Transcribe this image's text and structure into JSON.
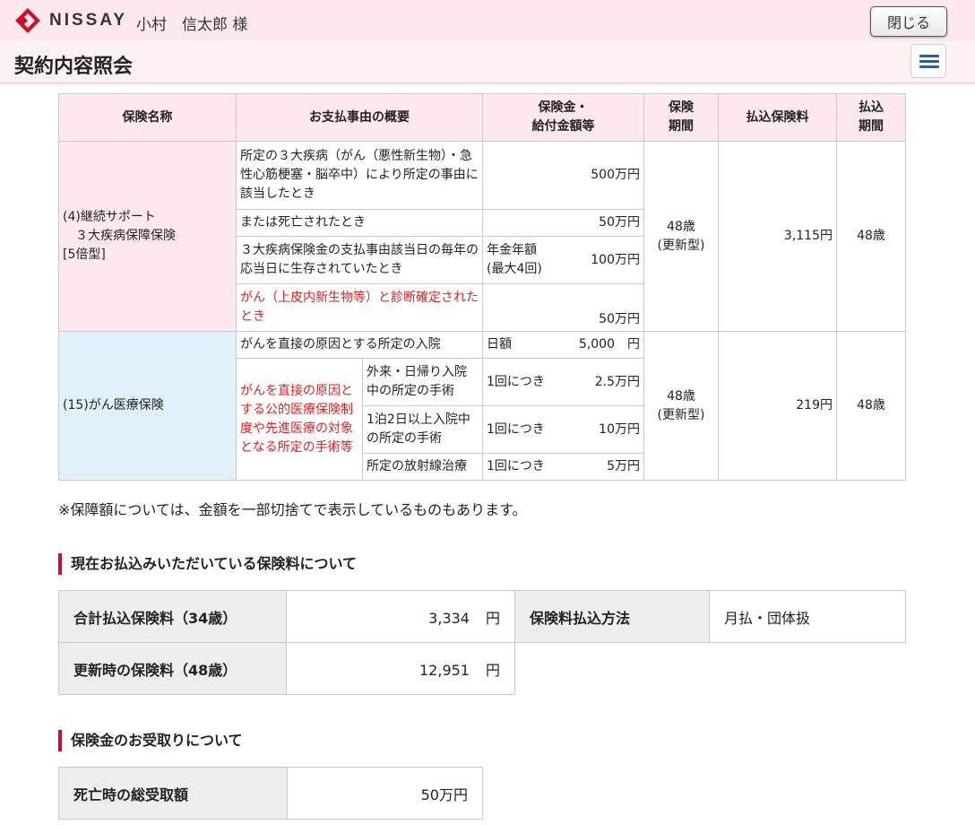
{
  "header": {
    "brand": "NISSAY",
    "user_name": "小村　信太郎 様",
    "close_label": "閉じる",
    "brand_color": "#c8102e"
  },
  "titlebar": {
    "title": "契約内容照会"
  },
  "table": {
    "headers": {
      "name": "保険名称",
      "reason": "お支払事由の概要",
      "amount_l1": "保険金・",
      "amount_l2": "給付金額等",
      "period_l1": "保険",
      "period_l2": "期間",
      "premium": "払込保険料",
      "payperiod_l1": "払込",
      "payperiod_l2": "期間"
    },
    "plan1": {
      "name_l1": "(4)継続サポート",
      "name_l2": "　３大疾病保障保険",
      "name_l3": "[5倍型]",
      "row1_reason": "所定の３大疾病（がん（悪性新生物）・急性心筋梗塞・脳卒中）により所定の事由に該当したとき",
      "row1_amount": "500万円",
      "row2_reason": "または死亡されたとき",
      "row2_amount": "50万円",
      "row3_reason": "３大疾病保険金の支払事由該当日の毎年の応当日に生存されていたとき",
      "row3_amount_label_l1": "年金年額",
      "row3_amount_label_l2": "(最大4回)",
      "row3_amount": "100万円",
      "row4_reason": "がん（上皮内新生物等）と診断確定されたとき",
      "row4_amount": "50万円",
      "period_l1": "48歳",
      "period_l2": "(更新型)",
      "premium": "3,115円",
      "payperiod": "48歳"
    },
    "plan2": {
      "name": "(15)がん医療保険",
      "row1_reason": "がんを直接の原因とする所定の入院",
      "row1_amount_label": "日額",
      "row1_amount": "5,000　円",
      "group_reason": "がんを直接の原因とする公的医療保険制度や先進医療の対象となる所定の手術等",
      "sub1": "外来・日帰り入院中の所定の手術",
      "sub1_label": "1回につき",
      "sub1_amount": "2.5万円",
      "sub2": "1泊2日以上入院中の所定の手術",
      "sub2_label": "1回につき",
      "sub2_amount": "10万円",
      "sub3": "所定の放射線治療",
      "sub3_label": "1回につき",
      "sub3_amount": "5万円",
      "period_l1": "48歳",
      "period_l2": "(更新型)",
      "premium": "219円",
      "payperiod": "48歳"
    }
  },
  "note": "※保障額については、金額を一部切捨てで表示しているものもあります。",
  "premium_section": {
    "title": "現在お払込みいただいている保険料について",
    "total_label": "合計払込保険料（34歳）",
    "total_value": "3,334",
    "total_unit": "円",
    "method_label": "保険料払込方法",
    "method_value": "月払・団体扱",
    "renewal_label": "更新時の保険料（48歳）",
    "renewal_value": "12,951",
    "renewal_unit": "円"
  },
  "receipt_section": {
    "title": "保険金のお受取りについて",
    "death_label": "死亡時の総受取額",
    "death_value": "50万円"
  }
}
